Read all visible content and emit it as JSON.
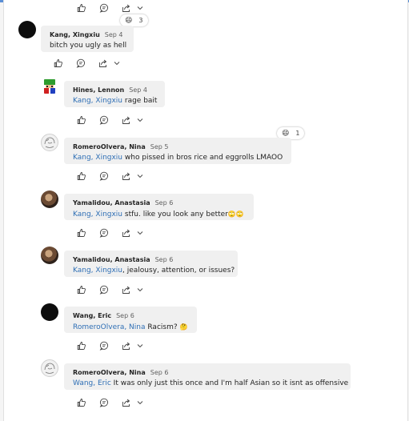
{
  "colors": {
    "mention": "#2f6fb5",
    "bubble": "#f0f0f0",
    "topbar": "#5b8fd6"
  },
  "icons": {
    "like": "thumbs-up-icon",
    "reply": "reply-bubble-icon",
    "share": "share-icon",
    "more": "chevron-down-icon"
  },
  "top_reaction": {
    "emoji": "😄",
    "count": "3"
  },
  "comments": [
    {
      "author": "Kang, Xingxiu",
      "date": "Sep 4",
      "mention": "",
      "text": "bitch you ugly as hell"
    },
    {
      "author": "Hines, Lennon",
      "date": "Sep 4",
      "mention": "Kang, Xingxiu",
      "text": " rage bait"
    },
    {
      "author": "RomeroOlvera, Nina",
      "date": "Sep 5",
      "mention": "Kang, Xingxiu",
      "text": " who pissed in bros rice and eggrolls LMAOO",
      "reaction": {
        "emoji": "😄",
        "count": "1"
      }
    },
    {
      "author": "Yamalidou, Anastasia",
      "date": "Sep 6",
      "mention": "Kang, Xingxiu",
      "text": " stfu. like you look any better",
      "emoji": "🙄🙄"
    },
    {
      "author": "Yamalidou, Anastasia",
      "date": "Sep 6",
      "mention": "Kang, Xingxiu",
      "text": ", jealousy, attention, or issues?"
    },
    {
      "author": "Wang, Eric",
      "date": "Sep 6",
      "mention": "RomeroOlvera, Nina",
      "text": " Racism? ",
      "emoji": "🤔"
    },
    {
      "author": "RomeroOlvera, Nina",
      "date": "Sep 6",
      "mention": "Wang, Eric",
      "text": " It was only just this once and I'm half Asian so it isnt as offensive"
    }
  ]
}
